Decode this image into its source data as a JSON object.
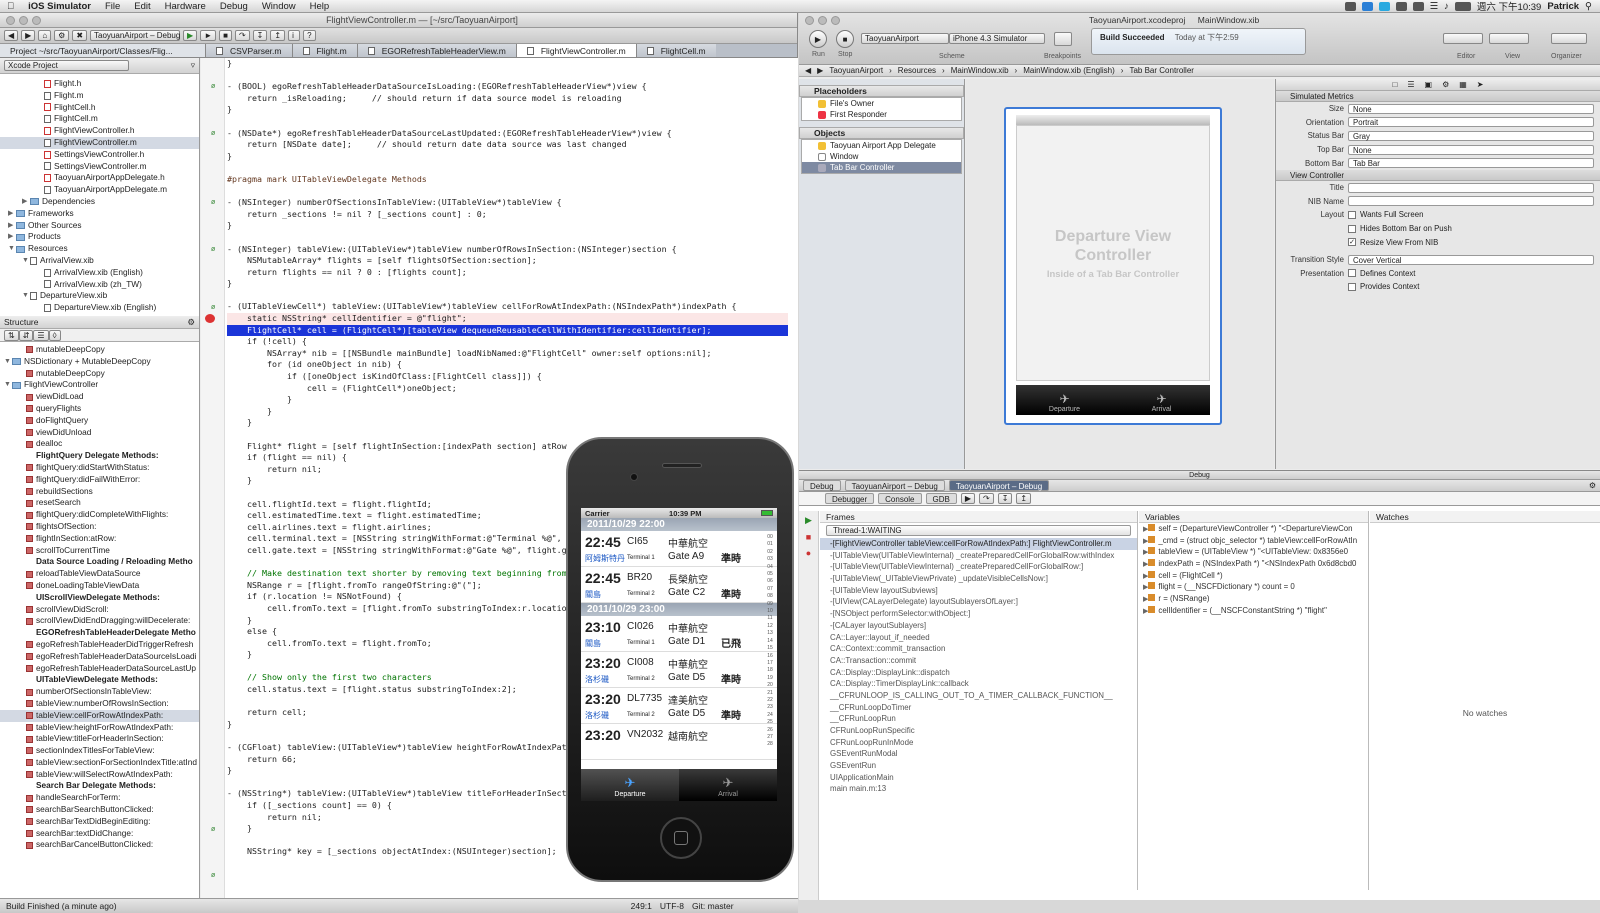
{
  "menubar": {
    "app": "iOS Simulator",
    "items": [
      "File",
      "Edit",
      "Hardware",
      "Debug",
      "Window",
      "Help"
    ],
    "clock": "週六 下午10:39",
    "user": "Patrick"
  },
  "left": {
    "title": "FlightViewController.m — [~/src/TaoyuanAirport]",
    "scheme": "TaoyuanAirport – Debug",
    "project_path": "Project ~/src/TaoyuanAirport/Classes/Flig...",
    "tabs": [
      "CSVParser.m",
      "Flight.m",
      "EGORefreshTableHeaderView.m",
      "FlightViewController.m",
      "FlightCell.m"
    ],
    "nav_selector": "Xcode Project",
    "files": [
      {
        "name": "Flight.h",
        "kind": "h"
      },
      {
        "name": "Flight.m",
        "kind": "m"
      },
      {
        "name": "FlightCell.h",
        "kind": "h"
      },
      {
        "name": "FlightCell.m",
        "kind": "m"
      },
      {
        "name": "FlightViewController.h",
        "kind": "h"
      },
      {
        "name": "FlightViewController.m",
        "kind": "m",
        "sel": true
      },
      {
        "name": "SettingsViewController.h",
        "kind": "h"
      },
      {
        "name": "SettingsViewController.m",
        "kind": "m"
      },
      {
        "name": "TaoyuanAirportAppDelegate.h",
        "kind": "h"
      },
      {
        "name": "TaoyuanAirportAppDelegate.m",
        "kind": "m"
      },
      {
        "name": "Dependencies",
        "kind": "folder",
        "lvl": 1
      },
      {
        "name": "Frameworks",
        "kind": "folder",
        "lvl": 0
      },
      {
        "name": "Other Sources",
        "kind": "folder",
        "lvl": 0
      },
      {
        "name": "Products",
        "kind": "folder",
        "lvl": 0
      },
      {
        "name": "Resources",
        "kind": "folder",
        "lvl": 0
      },
      {
        "name": "ArrivalView.xib",
        "kind": "xib",
        "lvl": 1
      },
      {
        "name": "ArrivalView.xib (English)",
        "kind": "xib",
        "lvl": 2
      },
      {
        "name": "ArrivalView.xib (zh_TW)",
        "kind": "xib",
        "lvl": 2
      },
      {
        "name": "DepartureView.xib",
        "kind": "xib",
        "lvl": 1
      },
      {
        "name": "DepartureView.xib (English)",
        "kind": "xib",
        "lvl": 2
      }
    ],
    "structure_title": "Structure",
    "structure": [
      [
        "mutableDeepCopy",
        0
      ],
      [
        "NSDictionary + MutableDeepCopy",
        -1
      ],
      [
        "mutableDeepCopy",
        0
      ],
      [
        "FlightViewController",
        -1
      ],
      [
        "viewDidLoad",
        0
      ],
      [
        "queryFlights",
        0
      ],
      [
        "doFlightQuery",
        0
      ],
      [
        "viewDidUnload",
        0
      ],
      [
        "dealloc",
        0
      ],
      [
        "FlightQuery Delegate Methods:",
        1
      ],
      [
        "flightQuery:didStartWithStatus:",
        0
      ],
      [
        "flightQuery:didFailWithError:",
        0
      ],
      [
        "rebuildSections",
        0
      ],
      [
        "resetSearch",
        0
      ],
      [
        "flightQuery:didCompleteWithFlights:",
        0
      ],
      [
        "flightsOfSection:",
        0
      ],
      [
        "flightInSection:atRow:",
        0
      ],
      [
        "scrollToCurrentTime",
        0
      ],
      [
        "Data Source Loading / Reloading Metho",
        1
      ],
      [
        "reloadTableViewDataSource",
        0
      ],
      [
        "doneLoadingTableViewData",
        0
      ],
      [
        "UIScrollViewDelegate Methods:",
        1
      ],
      [
        "scrollViewDidScroll:",
        0
      ],
      [
        "scrollViewDidEndDragging:willDecelerate:",
        0
      ],
      [
        "EGORefreshTableHeaderDelegate Metho",
        1
      ],
      [
        "egoRefreshTableHeaderDidTriggerRefresh",
        0
      ],
      [
        "egoRefreshTableHeaderDataSourceIsLoadi",
        0
      ],
      [
        "egoRefreshTableHeaderDataSourceLastUp",
        0
      ],
      [
        "UITableViewDelegate Methods:",
        1
      ],
      [
        "numberOfSectionsInTableView:",
        0
      ],
      [
        "tableView:numberOfRowsInSection:",
        0
      ],
      [
        "tableView:cellForRowAtIndexPath:",
        0
      ],
      [
        "tableView:heightForRowAtIndexPath:",
        0
      ],
      [
        "tableView:titleForHeaderInSection:",
        0
      ],
      [
        "sectionIndexTitlesForTableView:",
        0
      ],
      [
        "tableView:sectionForSectionIndexTitle:atInd",
        0
      ],
      [
        "tableView:willSelectRowAtIndexPath:",
        0
      ],
      [
        "Search Bar Delegate Methods:",
        1
      ],
      [
        "handleSearchForTerm:",
        0
      ],
      [
        "searchBarSearchButtonClicked:",
        0
      ],
      [
        "searchBarTextDidBeginEditing:",
        0
      ],
      [
        "searchBar:textDidChange:",
        0
      ],
      [
        "searchBarCancelButtonClicked:",
        0
      ]
    ],
    "status": "Build Finished (a minute ago)",
    "cursor": "249:1",
    "encoding": "UTF-8",
    "scm": "Git: master"
  },
  "code": [
    "}",
    "",
    "- (BOOL) egoRefreshTableHeaderDataSourceIsLoading:(EGORefreshTableHeaderView*)view {",
    "    return _isReloading;     // should return if data source model is reloading",
    "}",
    "",
    "- (NSDate*) egoRefreshTableHeaderDataSourceLastUpdated:(EGORefreshTableHeaderView*)view {",
    "    return [NSDate date];     // should return date data source was last changed",
    "}",
    "",
    "#pragma mark UITableViewDelegate Methods",
    "",
    "- (NSInteger) numberOfSectionsInTableView:(UITableView*)tableView {",
    "    return _sections != nil ? [_sections count] : 0;",
    "}",
    "",
    "- (NSInteger) tableView:(UITableView*)tableView numberOfRowsInSection:(NSInteger)section {",
    "    NSMutableArray* flights = [self flightsOfSection:section];",
    "    return flights == nil ? 0 : [flights count];",
    "}",
    "",
    "- (UITableViewCell*) tableView:(UITableView*)tableView cellForRowAtIndexPath:(NSIndexPath*)indexPath {",
    "    static NSString* cellIdentifier = @\"flight\";",
    "    FlightCell* cell = (FlightCell*)[tableView dequeueReusableCellWithIdentifier:cellIdentifier];",
    "    if (!cell) {",
    "        NSArray* nib = [[NSBundle mainBundle] loadNibNamed:@\"FlightCell\" owner:self options:nil];",
    "        for (id oneObject in nib) {",
    "            if ([oneObject isKindOfClass:[FlightCell class]]) {",
    "                cell = (FlightCell*)oneObject;",
    "            }",
    "        }",
    "    }",
    "",
    "    Flight* flight = [self flightInSection:[indexPath section] atRow",
    "    if (flight == nil) {",
    "        return nil;",
    "    }",
    "",
    "    cell.flightId.text = flight.flightId;",
    "    cell.estimatedTime.text = flight.estimatedTime;",
    "    cell.airlines.text = flight.airlines;",
    "    cell.terminal.text = [NSString stringWithFormat:@\"Terminal %@\",",
    "    cell.gate.text = [NSString stringWithFormat:@\"Gate %@\", flight.g",
    "",
    "    // Make destination text shorter by removing text beginning from",
    "    NSRange r = [flight.fromTo rangeOfString:@\"(\"];",
    "    if (r.location != NSNotFound) {",
    "        cell.fromTo.text = [flight.fromTo substringToIndex:r.locatio",
    "    }",
    "    else {",
    "        cell.fromTo.text = flight.fromTo;",
    "    }",
    "",
    "    // Show only the first two characters",
    "    cell.status.text = [flight.status substringToIndex:2];",
    "",
    "    return cell;",
    "}",
    "",
    "- (CGFloat) tableView:(UITableView*)tableView heightForRowAtIndexPat",
    "    return 66;",
    "}",
    "",
    "- (NSString*) tableView:(UITableView*)tableView titleForHeaderInSect",
    "    if ([_sections count] == 0) {",
    "        return nil;",
    "    }",
    "",
    "    NSString* key = [_sections objectAtIndex:(NSUInteger)section];"
  ],
  "right": {
    "title": "TaoyuanAirport.xcodeproj",
    "title2": "MainWindow.xib",
    "run": "Run",
    "stop": "Stop",
    "scheme_label": "Scheme",
    "breakpoints": "Breakpoints",
    "scheme_sel": "TaoyuanAirport",
    "device_sel": "iPhone 4.3 Simulator",
    "build_status": "Build Succeeded",
    "build_time": "Today at 下午2:59",
    "editor": "Editor",
    "view": "View",
    "organizer": "Organizer",
    "jumpbar": [
      "TaoyuanAirport",
      "Resources",
      "MainWindow.xib",
      "MainWindow.xib (English)",
      "Tab Bar Controller"
    ],
    "placeholders": "Placeholders",
    "objects": "Objects",
    "ph_items": [
      "File's Owner",
      "First Responder"
    ],
    "obj_items": [
      "Taoyuan Airport App Delegate",
      "Window",
      "Tab Bar Controller"
    ],
    "canvas_title": "Departure View Controller",
    "canvas_sub": "Inside of a Tab Bar Controller",
    "canvas_tabs": [
      "Departure",
      "Arrival"
    ],
    "insp_metrics": "Simulated Metrics",
    "metrics": [
      [
        "Size",
        "None"
      ],
      [
        "Orientation",
        "Portrait"
      ],
      [
        "Status Bar",
        "Gray"
      ],
      [
        "Top Bar",
        "None"
      ],
      [
        "Bottom Bar",
        "Tab Bar"
      ]
    ],
    "insp_vc": "View Controller",
    "vc_title": "Title",
    "vc_nib": "NIB Name",
    "vc_layout": "Layout",
    "layout_opts": [
      [
        "Wants Full Screen",
        false
      ],
      [
        "Hides Bottom Bar on Push",
        false
      ],
      [
        "Resize View From NIB",
        true
      ]
    ],
    "transition_lbl": "Transition Style",
    "transition": "Cover Vertical",
    "presentation_lbl": "Presentation",
    "pres_opts": [
      "Defines Context",
      "Provides Context"
    ],
    "debug_title": "Debug",
    "debug_tabs": [
      "Debug",
      "TaoyuanAirport – Debug",
      "TaoyuanAirport – Debug"
    ],
    "debugger": "Debugger",
    "console": "Console",
    "gdb": "GDB",
    "frames": "Frames",
    "thread": "Thread-1:WAITING",
    "frame_list": [
      "-[FlightViewController tableView:cellForRowAtIndexPath:] FlightViewController.m",
      "-[UITableView(UITableViewInternal) _createPreparedCellForGlobalRow:withIndex",
      "-[UITableView(UITableViewInternal) _createPreparedCellForGlobalRow:]",
      "-[UITableView(_UITableViewPrivate) _updateVisibleCellsNow:]",
      "-[UITableView layoutSubviews]",
      "-[UIView(CALayerDelegate) layoutSublayersOfLayer:]",
      "-[NSObject performSelector:withObject:]",
      "-[CALayer layoutSublayers]",
      "CA::Layer::layout_if_needed",
      "CA::Context::commit_transaction",
      "CA::Transaction::commit",
      "CA::Display::DisplayLink::dispatch",
      "CA::Display::TimerDisplayLink::callback",
      "__CFRUNLOOP_IS_CALLING_OUT_TO_A_TIMER_CALLBACK_FUNCTION__",
      "__CFRunLoopDoTimer",
      "__CFRunLoopRun",
      "CFRunLoopRunSpecific",
      "CFRunLoopRunInMode",
      "GSEventRunModal",
      "GSEventRun",
      "UIApplicationMain",
      "main main.m:13"
    ],
    "variables": "Variables",
    "var_list": [
      "self = (DepartureViewController *) \"<DepartureViewCon",
      "_cmd = (struct objc_selector *) tableView:cellForRowAtIn",
      "tableView = (UITableView *) \"<UITableView: 0x8356e0",
      "indexPath = (NSIndexPath *) \"<NSIndexPath 0x6d8cbd0",
      "cell = (FlightCell *)",
      "flight = (__NSCFDictionary *) count = 0",
      "r = (NSRange)",
      "cellIdentifier = (__NSCFConstantString *) \"flight\""
    ],
    "watches": "Watches",
    "no_watches": "No watches"
  },
  "phone": {
    "carrier": "Carrier",
    "time": "10:39 PM",
    "sections": [
      {
        "header": "2011/10/29 22:00",
        "rows": [
          {
            "time": "22:45",
            "id": "CI65",
            "air": "中華航空",
            "from": "阿姆斯特丹",
            "term": "Terminal 1",
            "gate": "Gate A9",
            "status": "準時"
          },
          {
            "time": "22:45",
            "id": "BR20",
            "air": "長榮航空",
            "from": "關島",
            "term": "Terminal 2",
            "gate": "Gate C2",
            "status": "準時"
          }
        ]
      },
      {
        "header": "2011/10/29 23:00",
        "rows": [
          {
            "time": "23:10",
            "id": "CI026",
            "air": "中華航空",
            "from": "關島",
            "term": "Terminal 1",
            "gate": "Gate D1",
            "status": "已飛"
          },
          {
            "time": "23:20",
            "id": "CI008",
            "air": "中華航空",
            "from": "洛杉磯",
            "term": "Terminal 2",
            "gate": "Gate D5",
            "status": "準時"
          },
          {
            "time": "23:20",
            "id": "DL7735",
            "air": "達美航空",
            "from": "洛杉磯",
            "term": "Terminal 2",
            "gate": "Gate D5",
            "status": "準時"
          },
          {
            "time": "23:20",
            "id": "VN2032",
            "air": "越南航空",
            "from": "",
            "term": "",
            "gate": "",
            "status": ""
          }
        ]
      }
    ],
    "index": [
      "00",
      "01",
      "02",
      "03",
      "04",
      "05",
      "06",
      "07",
      "08",
      "09",
      "10",
      "11",
      "12",
      "13",
      "14",
      "15",
      "16",
      "17",
      "18",
      "19",
      "20",
      "21",
      "22",
      "23",
      "24",
      "25",
      "26",
      "27",
      "28"
    ],
    "tabs": [
      "Departure",
      "Arrival"
    ]
  }
}
